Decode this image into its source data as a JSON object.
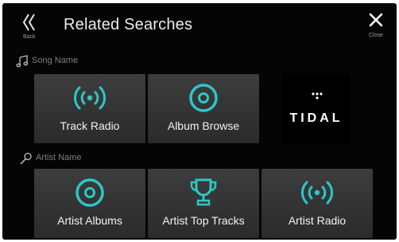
{
  "header": {
    "back_label": "Back",
    "title": "Related Searches",
    "close_label": "Close"
  },
  "sections": [
    {
      "label": "Song Name",
      "icon": "music-note-icon",
      "tiles": [
        {
          "label": "Track Radio",
          "icon": "radio-broadcast-icon"
        },
        {
          "label": "Album Browse",
          "icon": "disc-icon"
        }
      ],
      "logo": {
        "label": "TIDAL"
      }
    },
    {
      "label": "Artist Name",
      "icon": "microphone-icon",
      "tiles": [
        {
          "label": "Artist Albums",
          "icon": "disc-icon"
        },
        {
          "label": "Artist Top Tracks",
          "icon": "trophy-icon"
        },
        {
          "label": "Artist Radio",
          "icon": "radio-broadcast-icon"
        }
      ]
    }
  ],
  "colors": {
    "accent": "#2ec6c6",
    "background": "#050505",
    "tile": "#353535"
  }
}
